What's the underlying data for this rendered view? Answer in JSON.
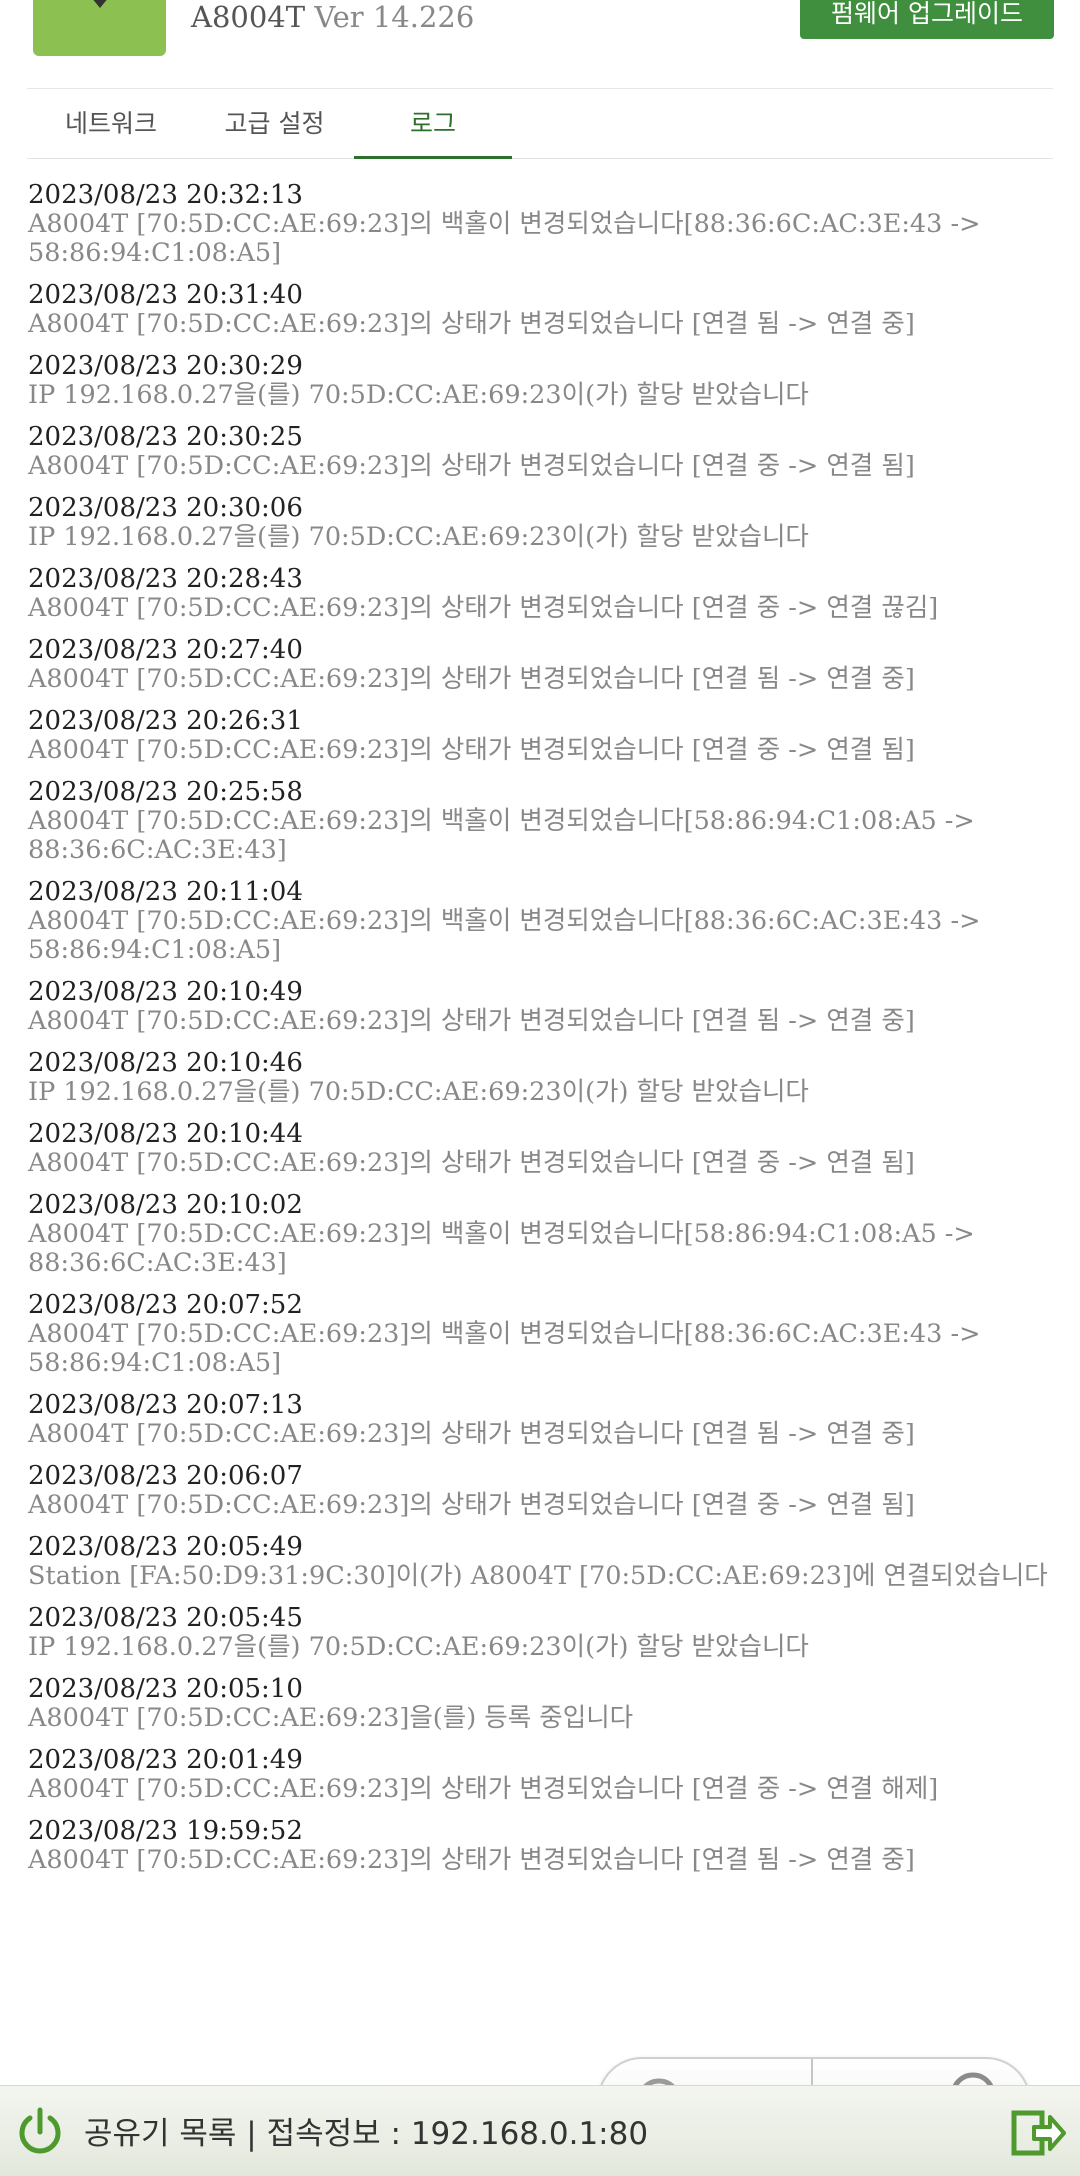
{
  "header": {
    "model": "A8004T",
    "version": "Ver 14.226",
    "firmware_button": "펌웨어 업그레이드"
  },
  "tabs": [
    {
      "label": "네트워크",
      "active": false
    },
    {
      "label": "고급 설정",
      "active": false
    },
    {
      "label": "로그",
      "active": true
    }
  ],
  "log": [
    {
      "time": "2023/08/23 20:32:13",
      "message": "A8004T [70:5D:CC:AE:69:23]의 백홀이 변경되었습니다[88:36:6C:AC:3E:43 ->\n58:86:94:C1:08:A5]"
    },
    {
      "time": "2023/08/23 20:31:40",
      "message": "A8004T [70:5D:CC:AE:69:23]의 상태가 변경되었습니다 [연결 됨 -> 연결 중]"
    },
    {
      "time": "2023/08/23 20:30:29",
      "message": "IP 192.168.0.27을(를) 70:5D:CC:AE:69:23이(가) 할당 받았습니다"
    },
    {
      "time": "2023/08/23 20:30:25",
      "message": "A8004T [70:5D:CC:AE:69:23]의 상태가 변경되었습니다 [연결 중 -> 연결 됨]"
    },
    {
      "time": "2023/08/23 20:30:06",
      "message": "IP 192.168.0.27을(를) 70:5D:CC:AE:69:23이(가) 할당 받았습니다"
    },
    {
      "time": "2023/08/23 20:28:43",
      "message": "A8004T [70:5D:CC:AE:69:23]의 상태가 변경되었습니다 [연결 중 -> 연결 끊김]"
    },
    {
      "time": "2023/08/23 20:27:40",
      "message": "A8004T [70:5D:CC:AE:69:23]의 상태가 변경되었습니다 [연결 됨 -> 연결 중]"
    },
    {
      "time": "2023/08/23 20:26:31",
      "message": "A8004T [70:5D:CC:AE:69:23]의 상태가 변경되었습니다 [연결 중 -> 연결 됨]"
    },
    {
      "time": "2023/08/23 20:25:58",
      "message": "A8004T [70:5D:CC:AE:69:23]의 백홀이 변경되었습니다[58:86:94:C1:08:A5 ->\n88:36:6C:AC:3E:43]"
    },
    {
      "time": "2023/08/23 20:11:04",
      "message": "A8004T [70:5D:CC:AE:69:23]의 백홀이 변경되었습니다[88:36:6C:AC:3E:43 ->\n58:86:94:C1:08:A5]"
    },
    {
      "time": "2023/08/23 20:10:49",
      "message": "A8004T [70:5D:CC:AE:69:23]의 상태가 변경되었습니다 [연결 됨 -> 연결 중]"
    },
    {
      "time": "2023/08/23 20:10:46",
      "message": "IP 192.168.0.27을(를) 70:5D:CC:AE:69:23이(가) 할당 받았습니다"
    },
    {
      "time": "2023/08/23 20:10:44",
      "message": "A8004T [70:5D:CC:AE:69:23]의 상태가 변경되었습니다 [연결 중 -> 연결 됨]"
    },
    {
      "time": "2023/08/23 20:10:02",
      "message": "A8004T [70:5D:CC:AE:69:23]의 백홀이 변경되었습니다[58:86:94:C1:08:A5 ->\n88:36:6C:AC:3E:43]"
    },
    {
      "time": "2023/08/23 20:07:52",
      "message": "A8004T [70:5D:CC:AE:69:23]의 백홀이 변경되었습니다[88:36:6C:AC:3E:43 ->\n58:86:94:C1:08:A5]"
    },
    {
      "time": "2023/08/23 20:07:13",
      "message": "A8004T [70:5D:CC:AE:69:23]의 상태가 변경되었습니다 [연결 됨 -> 연결 중]"
    },
    {
      "time": "2023/08/23 20:06:07",
      "message": "A8004T [70:5D:CC:AE:69:23]의 상태가 변경되었습니다 [연결 중 -> 연결 됨]"
    },
    {
      "time": "2023/08/23 20:05:49",
      "message": "Station [FA:50:D9:31:9C:30]이(가) A8004T [70:5D:CC:AE:69:23]에 연결되었습니다"
    },
    {
      "time": "2023/08/23 20:05:45",
      "message": "IP 192.168.0.27을(를) 70:5D:CC:AE:69:23이(가) 할당 받았습니다"
    },
    {
      "time": "2023/08/23 20:05:10",
      "message": "A8004T [70:5D:CC:AE:69:23]을(를) 등록 중입니다"
    },
    {
      "time": "2023/08/23 20:01:49",
      "message": "A8004T [70:5D:CC:AE:69:23]의 상태가 변경되었습니다 [연결 중 -> 연결 해제]"
    },
    {
      "time": "2023/08/23 19:59:52",
      "message": "A8004T [70:5D:CC:AE:69:23]의 상태가 변경되었습니다 [연결 됨 -> 연결 중]"
    }
  ],
  "bottom_bar": {
    "text": "공유기 목록 | 접속정보 : 192.168.0.1:80"
  },
  "colors": {
    "accent_green": "#3f8f3f",
    "logo_green": "#8cc152",
    "tab_active": "#2e6f2e"
  }
}
